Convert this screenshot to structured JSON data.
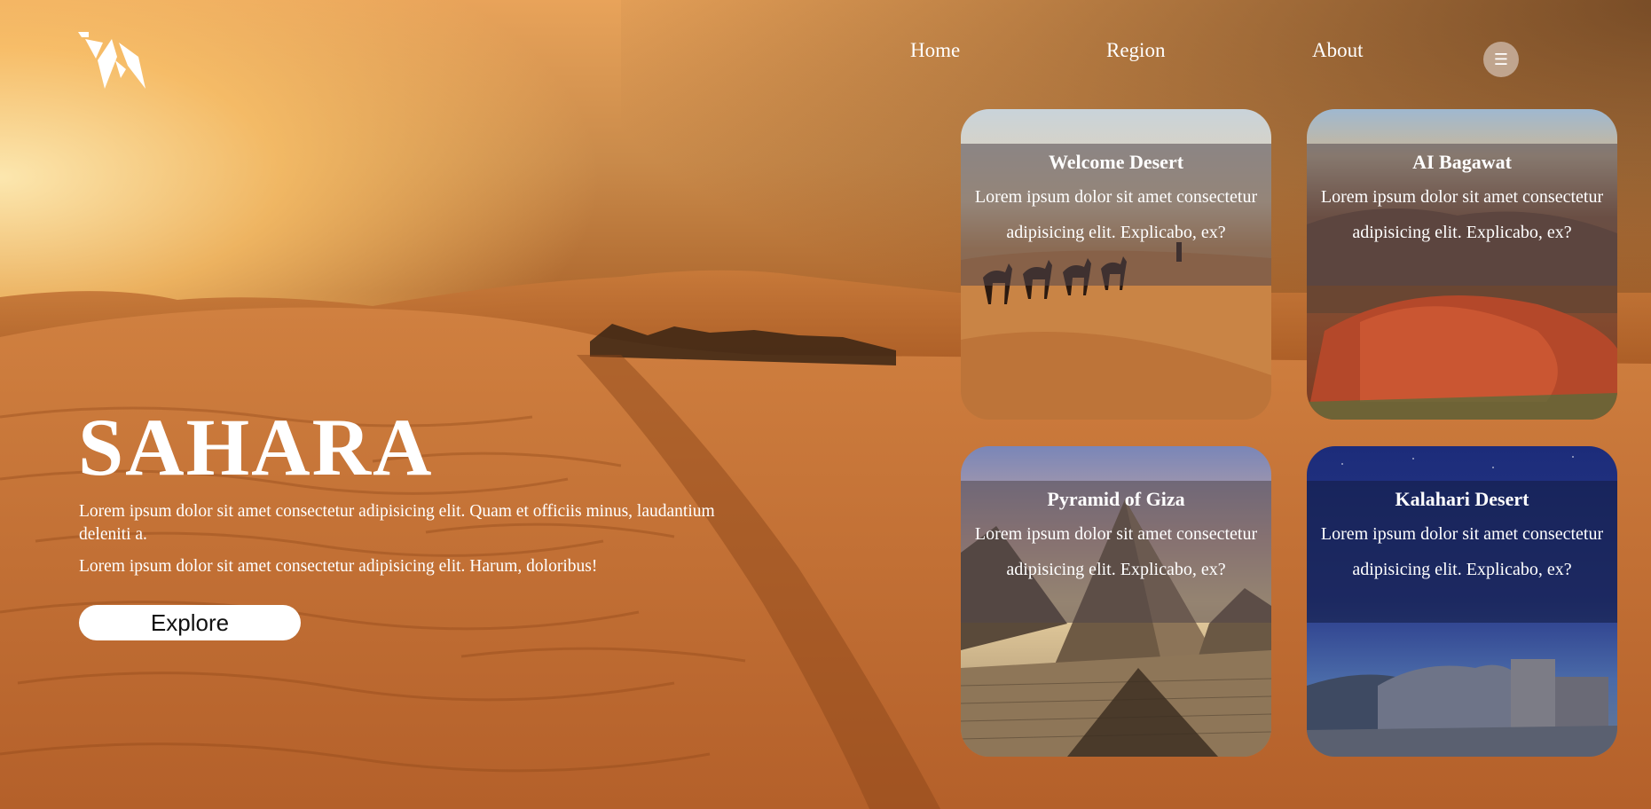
{
  "nav": {
    "items": [
      "Home",
      "Region",
      "About"
    ],
    "menu_icon": "hamburger-icon"
  },
  "logo": {
    "icon": "camel-logo-icon"
  },
  "hero": {
    "title": "SAHARA",
    "paragraph1": "Lorem ipsum dolor sit amet consectetur adipisicing elit. Quam et officiis minus, laudantium deleniti a.",
    "paragraph2": "Lorem ipsum dolor sit amet consectetur adipisicing elit. Harum, doloribus!",
    "button": "Explore"
  },
  "cards": [
    {
      "title": "Welcome Desert",
      "text": "Lorem ipsum dolor sit amet consectetur adipisicing elit. Explicabo, ex?"
    },
    {
      "title": "AI Bagawat",
      "text": "Lorem ipsum dolor sit amet consectetur adipisicing elit. Explicabo, ex?"
    },
    {
      "title": "Pyramid of Giza",
      "text": "Lorem ipsum dolor sit amet consectetur adipisicing elit. Explicabo, ex?"
    },
    {
      "title": "Kalahari Desert",
      "text": "Lorem ipsum dolor sit amet consectetur adipisicing elit. Explicabo, ex?"
    }
  ],
  "colors": {
    "text": "#ffffff",
    "button_bg": "#ffffff",
    "button_text": "#111111",
    "sand": "#c0702d"
  }
}
